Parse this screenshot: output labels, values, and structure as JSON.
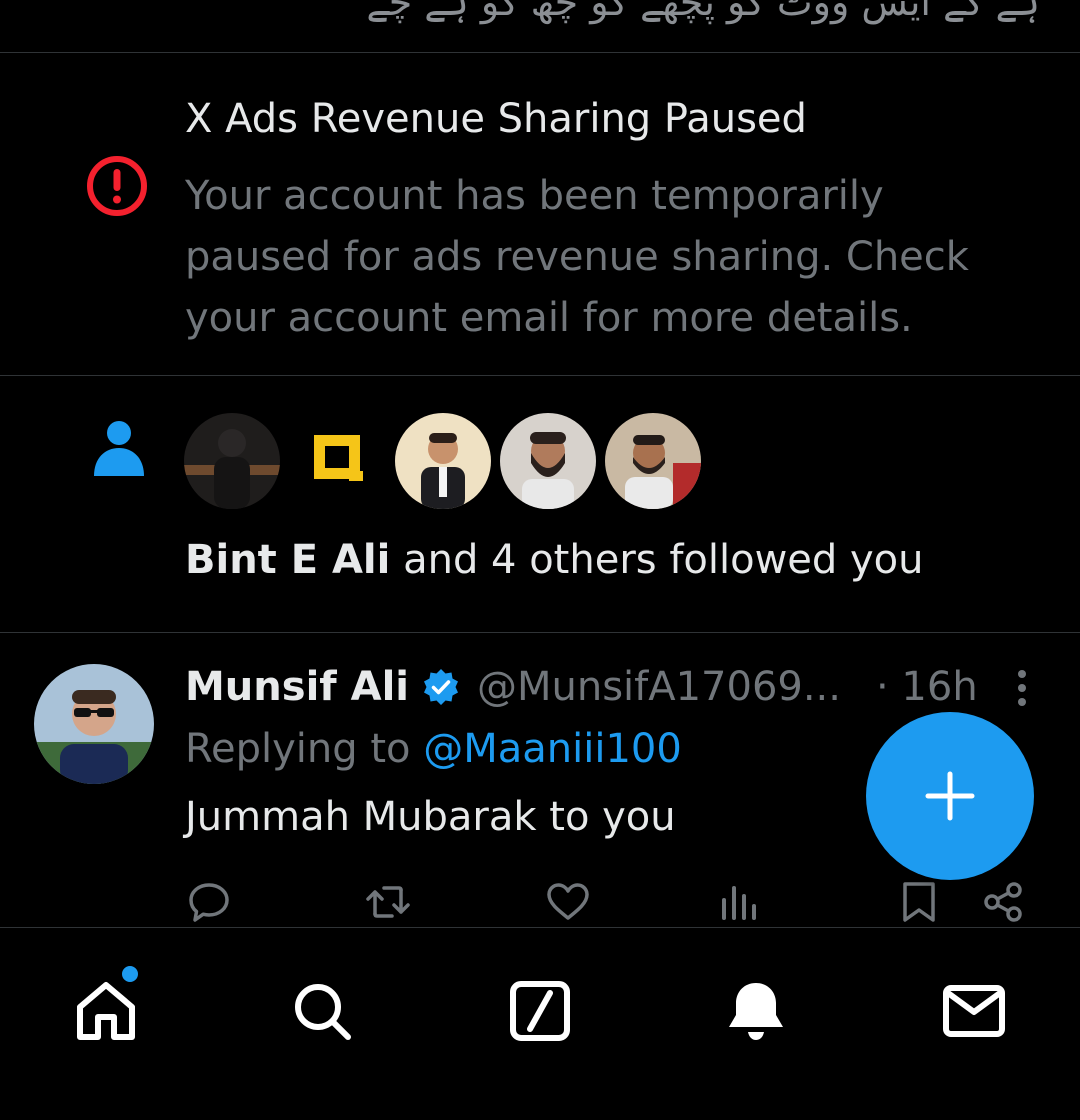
{
  "top_strip": {
    "text": "ہے کے ایس ووٹ کو پچھے کو چھ کو ہے چے"
  },
  "notice": {
    "icon": "alert-circle-icon",
    "title": "X Ads Revenue Sharing Paused",
    "body": "Your account has been temporarily paused for ads revenue sharing. Check your account email for more details.",
    "icon_color": "#f4212e"
  },
  "follow_notification": {
    "icon": "person-icon",
    "name": "Bint E Ali",
    "rest": " and 4 others followed you",
    "avatar_count": 5
  },
  "tweet": {
    "author_name": "Munsif Ali",
    "handle": "@MunsifA17069...",
    "time": "· 16h",
    "replying_prefix": "Replying to ",
    "replying_to": "@Maaniii100",
    "text": "Jummah Mubarak to you",
    "verified": true
  },
  "actions": [
    "reply-icon",
    "retweet-icon",
    "like-icon",
    "views-icon",
    "bookmark-icon",
    "share-icon"
  ],
  "nav": [
    "home-icon",
    "search-icon",
    "grok-icon",
    "notifications-icon",
    "messages-icon"
  ],
  "colors": {
    "accent": "#1d9bf0",
    "background": "#000000",
    "secondary_text": "#71767b",
    "alert": "#f4212e"
  }
}
